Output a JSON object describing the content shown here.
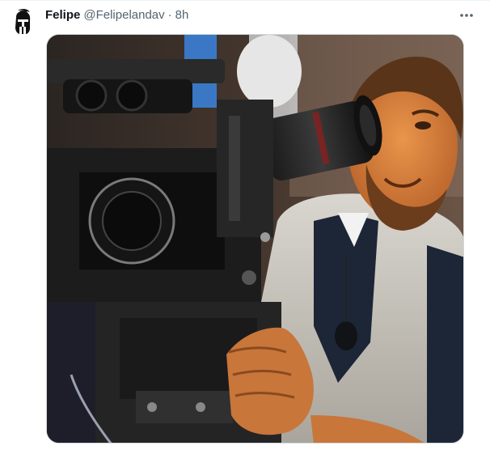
{
  "tweet": {
    "display_name": "Felipe",
    "handle": "@Felipelandav",
    "separator": "·",
    "timestamp": "8h",
    "more_icon": "more-horizontal-icon",
    "avatar_icon": "spartan-helmet-icon"
  },
  "media": {
    "kind": "photo",
    "icon": "photo"
  },
  "colors": {
    "name": "#0f1419",
    "secondary": "#536471",
    "border": "#cfd9de"
  }
}
